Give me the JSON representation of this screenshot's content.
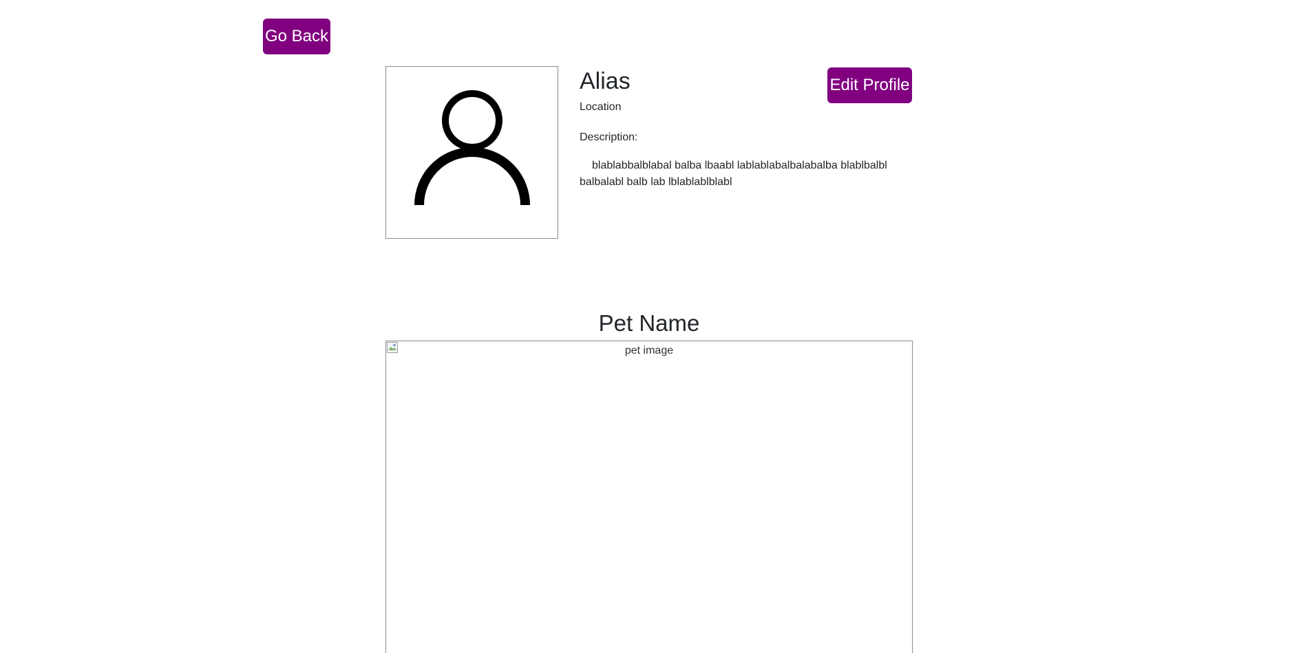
{
  "navigation": {
    "go_back_label": "Go Back"
  },
  "profile": {
    "avatar_icon": "user-icon",
    "alias": "Alias",
    "location": "Location",
    "description_label": "Description:",
    "description_text": "blablabbalblabal balba lbaabl lablablabalbalabalba blablbalbl balbalabl balb lab lblablablblabl",
    "edit_label": "Edit Profile"
  },
  "pet": {
    "name": "Pet Name",
    "image_alt": "pet image",
    "broken_image_icon": "broken-image-icon"
  },
  "colors": {
    "accent": "#800080",
    "button_text": "#ffffff",
    "border": "#8a8a8a"
  }
}
